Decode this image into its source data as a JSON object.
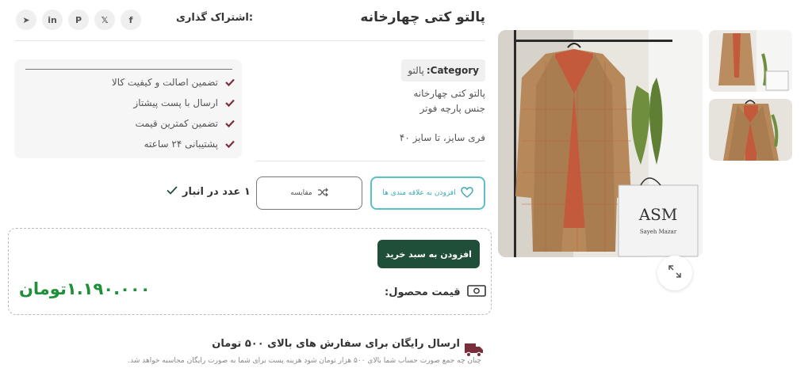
{
  "product": {
    "title": "پالتو کتی چهارخانه",
    "category_label": "Category:",
    "category_value": "پالتو",
    "description_lines": [
      "پالتو کتی چهارخانه",
      "جنس پارچه فوتر",
      "فری سایز، تا سایز ۴۰"
    ]
  },
  "share": {
    "label": "اشتراک گذاری:",
    "networks": [
      {
        "icon": "facebook-icon",
        "glyph": "f"
      },
      {
        "icon": "x-icon",
        "glyph": "𝕏"
      },
      {
        "icon": "pinterest-icon",
        "glyph": "P"
      },
      {
        "icon": "linkedin-icon",
        "glyph": "in"
      },
      {
        "icon": "telegram-icon",
        "glyph": "➤"
      }
    ]
  },
  "guarantees": [
    "تضمین اصالت و کیفیت کالا",
    "ارسال با پست پیشتاز",
    "تضمین کمترین قیمت",
    "پشتیبانی ۲۴ ساعته"
  ],
  "actions": {
    "wishlist_label": "افزودن به علاقه مندی ها",
    "compare_label": "مقایسه",
    "add_to_cart_label": "افزودن به سبد خرید"
  },
  "stock": {
    "text": "۱ عدد در انبار"
  },
  "price": {
    "label": "قیمت محصول:",
    "value": "۱.۱۹۰.۰۰۰تومان"
  },
  "shipping": {
    "title": "ارسال رایگان برای سفارش های بالای ۵۰۰ تومان",
    "subtitle": "چنان چه جمع صورت حساب شما بالای ۵۰۰ هزار تومان شود هزینه پست برای شما به صورت رایگان محاسبه خواهد شد."
  },
  "gallery": {
    "brand_mark": "ASM",
    "brand_sub": "Sayeh Mazar"
  },
  "colors": {
    "accent": "#1f4f38",
    "price": "#1f8f3a",
    "wishlist": "#5bc0c9",
    "check": "#7a2e3b"
  }
}
